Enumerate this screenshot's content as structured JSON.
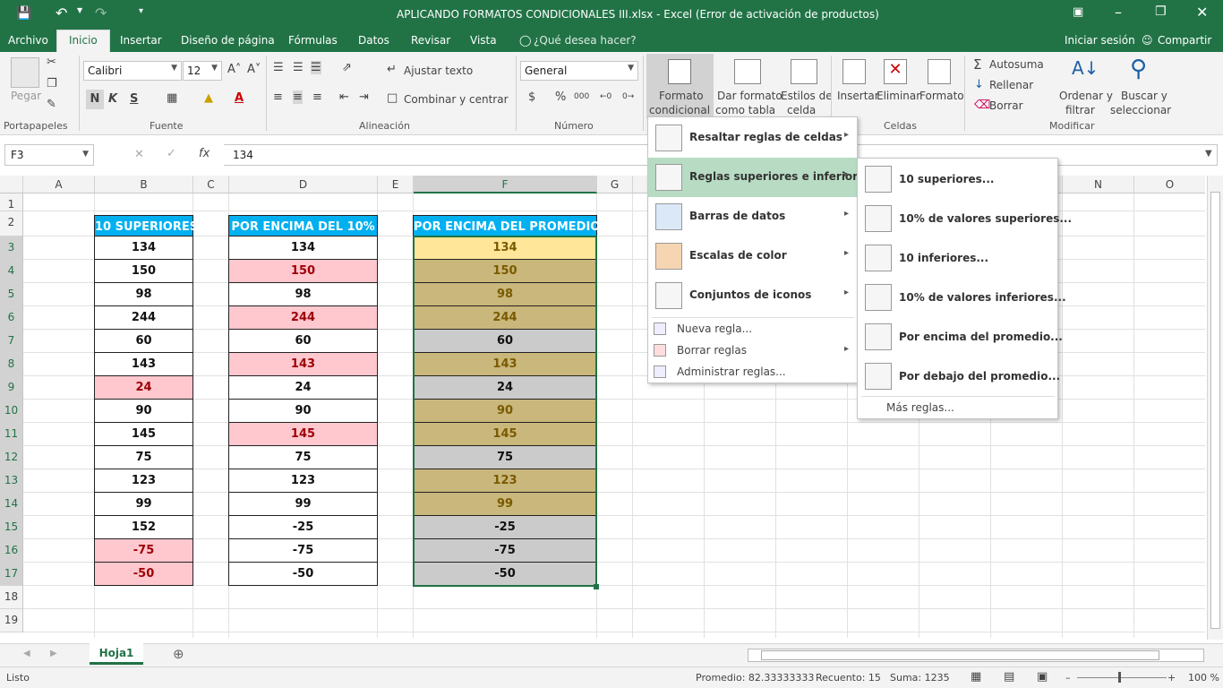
{
  "title": "APLICANDO FORMATOS CONDICIONALES III.xlsx - Excel (Error de activación de productos)",
  "tabs": [
    "Archivo",
    "Inicio",
    "Insertar",
    "Diseño de página",
    "Fórmulas",
    "Datos",
    "Revisar",
    "Vista"
  ],
  "tell_me": "¿Qué desea hacer?",
  "signin": "Iniciar sesión",
  "share": "Compartir",
  "ribbon": {
    "paste": "Pegar",
    "font_name": "Calibri",
    "font_size": "12",
    "bold": "N",
    "italic": "K",
    "underline": "S",
    "wrap": "Ajustar texto",
    "merge": "Combinar y centrar",
    "number_format": "General",
    "cond1": "Formato",
    "cond2": "condicional",
    "table1": "Dar formato",
    "table2": "como tabla",
    "styles1": "Estilos de",
    "styles2": "celda",
    "insert": "Insertar",
    "delete": "Eliminar",
    "format": "Formato",
    "autosum": "Autosuma",
    "fill": "Rellenar",
    "clear": "Borrar",
    "sort1": "Ordenar y",
    "sort2": "filtrar",
    "find1": "Buscar y",
    "find2": "seleccionar",
    "groups": {
      "clipboard": "Portapapeles",
      "font": "Fuente",
      "alignment": "Alineación",
      "number": "Número",
      "cells": "Celdas",
      "editing": "Modificar"
    }
  },
  "namebox": "F3",
  "formula": "134",
  "columns": [
    "A",
    "B",
    "C",
    "D",
    "E",
    "F",
    "G",
    "",
    "",
    "",
    "",
    "N",
    "O"
  ],
  "rows": [
    "1",
    "2",
    "3",
    "4",
    "5",
    "6",
    "7",
    "8",
    "9",
    "10",
    "11",
    "12",
    "13",
    "14",
    "15",
    "16",
    "17",
    "18",
    "19"
  ],
  "headers": {
    "b": "10 SUPERIORES",
    "d": "POR ENCIMA DEL 10%",
    "f": "POR ENCIMA DEL PROMEDIO"
  },
  "colB": [
    [
      "134",
      ""
    ],
    [
      "150",
      ""
    ],
    [
      "98",
      ""
    ],
    [
      "244",
      ""
    ],
    [
      "60",
      ""
    ],
    [
      "143",
      ""
    ],
    [
      "24",
      "pink"
    ],
    [
      "90",
      ""
    ],
    [
      "145",
      ""
    ],
    [
      "75",
      ""
    ],
    [
      "123",
      ""
    ],
    [
      "99",
      ""
    ],
    [
      "152",
      ""
    ],
    [
      "-75",
      "pink"
    ],
    [
      "-50",
      "pink"
    ]
  ],
  "colD": [
    [
      "134",
      ""
    ],
    [
      "150",
      "pink"
    ],
    [
      "98",
      ""
    ],
    [
      "244",
      "pink"
    ],
    [
      "60",
      ""
    ],
    [
      "143",
      "pink"
    ],
    [
      "24",
      ""
    ],
    [
      "90",
      ""
    ],
    [
      "145",
      "pink"
    ],
    [
      "75",
      ""
    ],
    [
      "123",
      ""
    ],
    [
      "99",
      ""
    ],
    [
      "-25",
      ""
    ],
    [
      "-75",
      ""
    ],
    [
      "-50",
      ""
    ]
  ],
  "colF": [
    [
      "134",
      "gold first"
    ],
    [
      "150",
      "gold"
    ],
    [
      "98",
      "gold"
    ],
    [
      "244",
      "gold"
    ],
    [
      "60",
      "gray"
    ],
    [
      "143",
      "gold"
    ],
    [
      "24",
      "gray"
    ],
    [
      "90",
      "gold"
    ],
    [
      "145",
      "gold"
    ],
    [
      "75",
      "gray"
    ],
    [
      "123",
      "gold"
    ],
    [
      "99",
      "gold"
    ],
    [
      "-25",
      "gray"
    ],
    [
      "-75",
      "gray"
    ],
    [
      "-50",
      "gray"
    ]
  ],
  "menu1": {
    "items": [
      "Resaltar reglas de celdas",
      "Reglas superiores e inferiores",
      "Barras de datos",
      "Escalas de color",
      "Conjuntos de iconos"
    ],
    "small": [
      "Nueva regla...",
      "Borrar reglas",
      "Administrar reglas..."
    ]
  },
  "menu2": {
    "items": [
      "10 superiores...",
      "10% de valores superiores...",
      "10 inferiores...",
      "10% de valores inferiores...",
      "Por encima del promedio...",
      "Por debajo del promedio..."
    ],
    "more": "Más reglas..."
  },
  "sheet": "Hoja1",
  "status": {
    "ready": "Listo",
    "avg": "Promedio: 82.33333333",
    "count": "Recuento: 15",
    "sum": "Suma: 1235",
    "zoom": "100 %"
  }
}
